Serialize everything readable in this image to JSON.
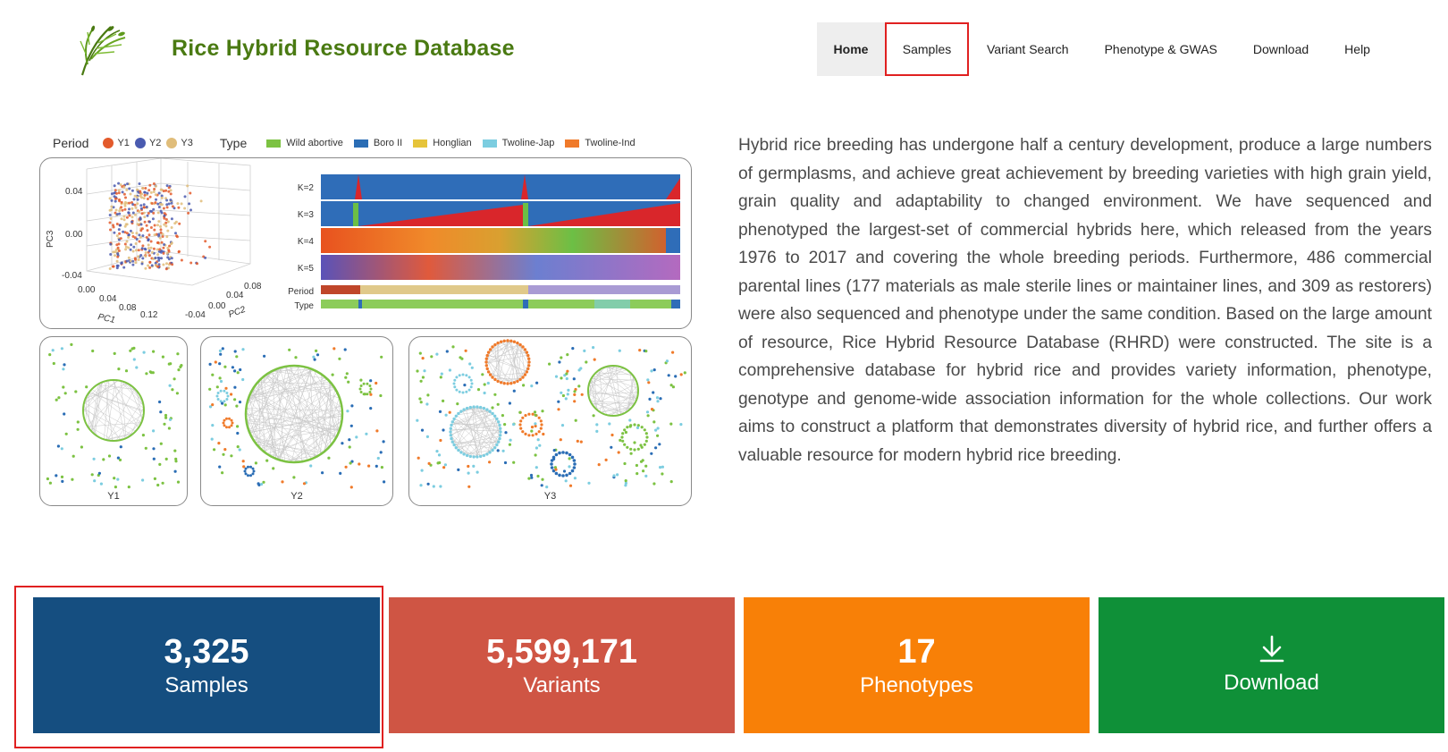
{
  "header": {
    "site_title": "Rice Hybrid Resource Database",
    "logo_icon": "rice-plant-icon"
  },
  "nav": {
    "items": [
      {
        "label": "Home"
      },
      {
        "label": "Samples"
      },
      {
        "label": "Variant Search"
      },
      {
        "label": "Phenotype & GWAS"
      },
      {
        "label": "Download"
      },
      {
        "label": "Help"
      }
    ]
  },
  "figure": {
    "legend": {
      "period_title": "Period",
      "periods": [
        {
          "label": "Y1",
          "color": "#e35a2b"
        },
        {
          "label": "Y2",
          "color": "#4a5bb0"
        },
        {
          "label": "Y3",
          "color": "#e0bd7a"
        }
      ],
      "type_title": "Type",
      "types": [
        {
          "label": "Wild abortive",
          "color": "#7cc242"
        },
        {
          "label": "Boro II",
          "color": "#2a6db5"
        },
        {
          "label": "Honglian",
          "color": "#e6c43a"
        },
        {
          "label": "Twoline-Jap",
          "color": "#7ccde0"
        },
        {
          "label": "Twoline-Ind",
          "color": "#f07a2a"
        }
      ]
    },
    "pca": {
      "pc3_label": "PC3",
      "pc1_label": "PC1",
      "pc2_label": "PC2",
      "pc3_ticks": [
        "0.04",
        "0.00",
        "-0.04"
      ],
      "pc1_ticks": [
        "0.00",
        "0.04",
        "0.08",
        "0.12"
      ],
      "pc2_ticks": [
        "-0.04",
        "0.00",
        "0.04",
        "0.08"
      ]
    },
    "structure": {
      "rows": [
        "K=2",
        "K=3",
        "K=4",
        "K=5",
        "Period",
        "Type"
      ]
    },
    "networks": [
      {
        "caption": "Y1"
      },
      {
        "caption": "Y2"
      },
      {
        "caption": "Y3"
      }
    ]
  },
  "description": "Hybrid rice breeding has undergone half a century development, produce a large numbers of germplasms, and achieve great achievement by breeding varieties with high grain yield, grain quality and adaptability to changed environment. We have sequenced and phenotyped the largest-set of commercial hybrids here, which released from the years 1976 to 2017 and covering the whole breeding periods. Furthermore, 486 commercial parental lines (177 materials as male sterile lines or maintainer lines, and 309 as restorers) were also sequenced and phenotype under the same condition. Based on the large amount of resource, Rice Hybrid Resource Database (RHRD) were constructed. The site is a comprehensive database for hybrid rice and provides variety information, phenotype, genotype and genome-wide association information for the whole collections. Our work aims to construct a platform that demonstrates diversity of hybrid rice, and further offers a valuable resource for modern hybrid rice breeding.",
  "stats": [
    {
      "value": "3,325",
      "label": "Samples",
      "color": "#154e80"
    },
    {
      "value": "5,599,171",
      "label": "Variants",
      "color": "#cf5544"
    },
    {
      "value": "17",
      "label": "Phenotypes",
      "color": "#f88007"
    },
    {
      "value": "",
      "label": "Download",
      "color": "#0f9038",
      "icon": "download-icon"
    }
  ]
}
